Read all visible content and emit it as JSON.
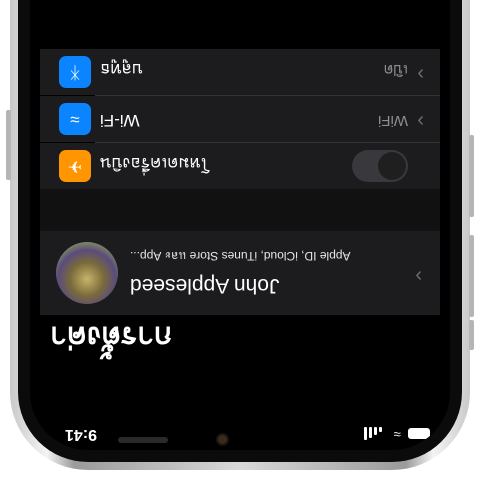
{
  "status_bar": {
    "time": "9:41"
  },
  "header": {
    "title": "การตั้งค่า"
  },
  "profile": {
    "name": "John Appleseed",
    "subtitle": "Apple ID, iCloud, iTunes Store และ App..."
  },
  "settings": {
    "airplane": {
      "label": "โหมดเครื่องบิน",
      "enabled": false
    },
    "wifi": {
      "label": "Wi-Fi",
      "value": "WiFi"
    },
    "bluetooth": {
      "label": "บลูทูธ",
      "value": "เปิด"
    }
  },
  "colors": {
    "airplane_icon": "#ff9500",
    "wifi_icon": "#0a84ff",
    "bluetooth_icon": "#0a84ff"
  },
  "icons": {
    "airplane": "airplane-icon",
    "wifi": "wifi-icon",
    "bluetooth": "bluetooth-icon",
    "chevron": "chevron-right-icon"
  }
}
